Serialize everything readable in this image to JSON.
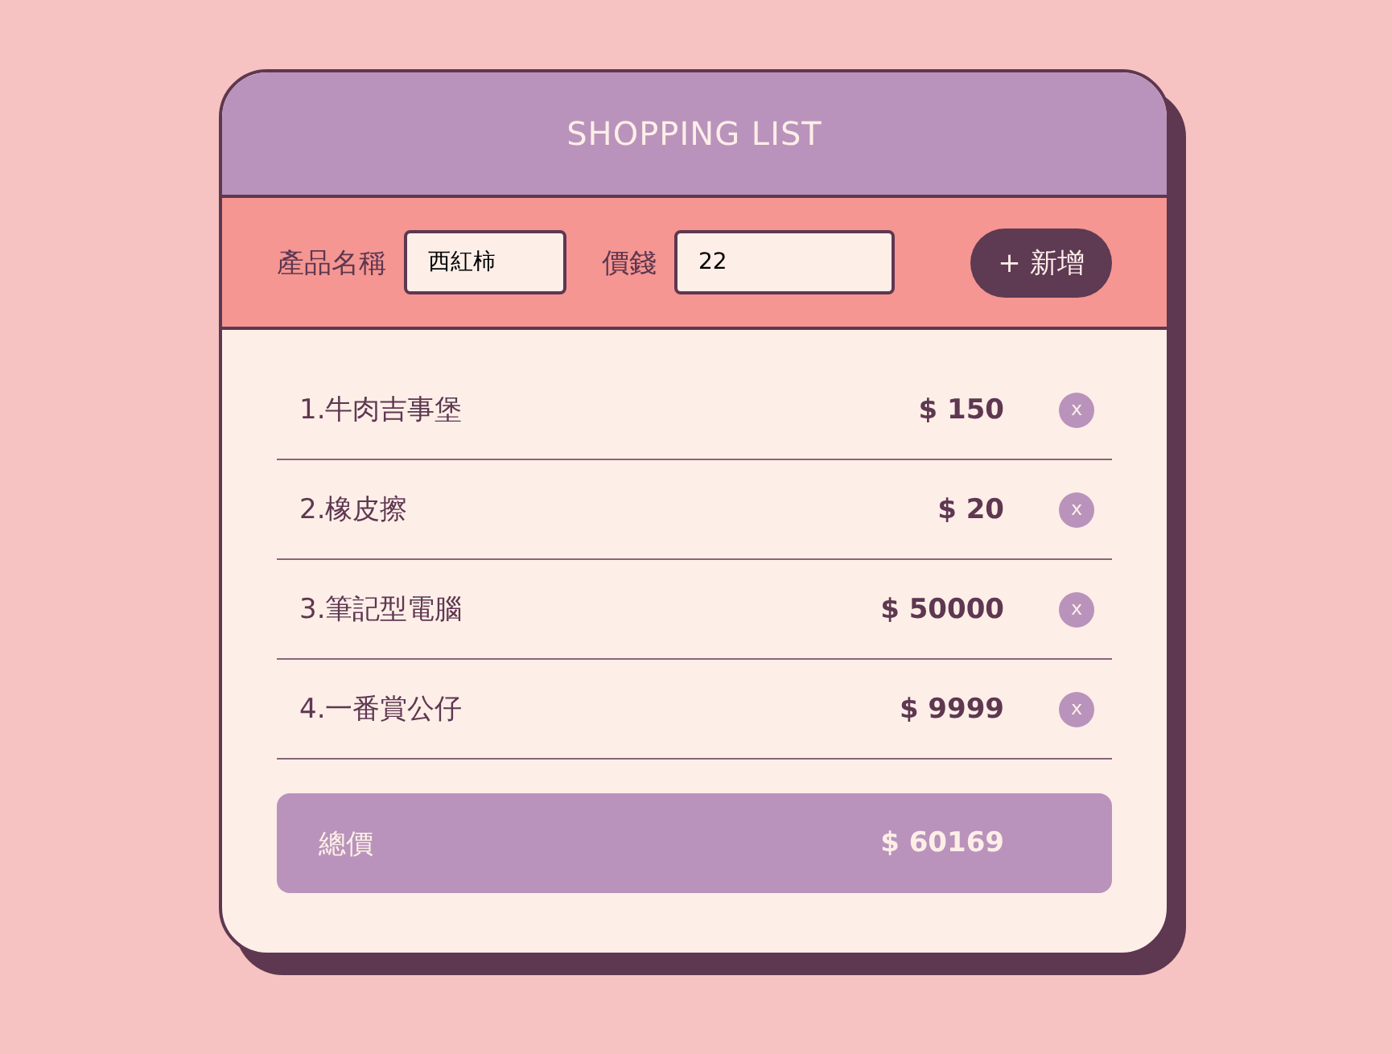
{
  "header": {
    "title": "SHOPPING LIST"
  },
  "form": {
    "name_label": "產品名稱",
    "name_value": "西紅柿",
    "price_label": "價錢",
    "price_value": "22",
    "add_button": "+ 新增"
  },
  "items": [
    {
      "name": "1.牛肉吉事堡",
      "price": "$ 150",
      "delete": "x"
    },
    {
      "name": "2.橡皮擦",
      "price": "$ 20",
      "delete": "x"
    },
    {
      "name": "3.筆記型電腦",
      "price": "$ 50000",
      "delete": "x"
    },
    {
      "name": "4.一番賞公仔",
      "price": "$ 9999",
      "delete": "x"
    }
  ],
  "total": {
    "label": "總價",
    "value": "$ 60169"
  }
}
